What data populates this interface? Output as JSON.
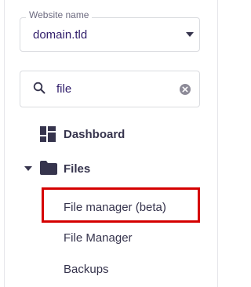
{
  "website_select": {
    "label": "Website name",
    "value": "domain.tld",
    "icon": "caret-down-icon"
  },
  "search": {
    "value": "file",
    "icon": "search-icon",
    "clear_icon": "clear-icon"
  },
  "nav": {
    "dashboard": {
      "label": "Dashboard",
      "icon": "dashboard-icon"
    },
    "files": {
      "label": "Files",
      "icon": "folder-icon",
      "expanded": true,
      "children": [
        {
          "label": "File manager (beta)"
        },
        {
          "label": "File Manager"
        },
        {
          "label": "Backups"
        }
      ]
    }
  },
  "highlight_color": "#d50000"
}
